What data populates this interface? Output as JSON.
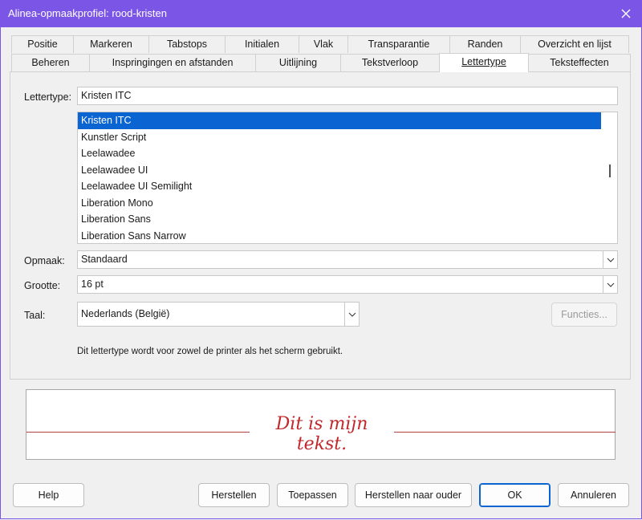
{
  "window": {
    "title": "Alinea-opmaakprofiel: rood-kristen"
  },
  "tabs_row1": [
    "Positie",
    "Markeren",
    "Tabstops",
    "Initialen",
    "Vlak",
    "Transparantie",
    "Randen",
    "Overzicht en lijst"
  ],
  "tabs_row2": [
    "Beheren",
    "Inspringingen en afstanden",
    "Uitlijning",
    "Tekstverloop",
    "Lettertype",
    "Teksteffecten"
  ],
  "active_tab": "Lettertype",
  "font": {
    "label": "Lettertype:",
    "value": "Kristen ITC",
    "list": [
      "Kristen ITC",
      "Kunstler Script",
      "Leelawadee",
      "Leelawadee UI",
      "Leelawadee UI Semilight",
      "Liberation Mono",
      "Liberation Sans",
      "Liberation Sans Narrow"
    ],
    "selected_index": 0
  },
  "style": {
    "label": "Opmaak:",
    "value": "Standaard"
  },
  "size": {
    "label": "Grootte:",
    "value": "16 pt"
  },
  "language": {
    "label": "Taal:",
    "value": "Nederlands (België)"
  },
  "features_button": "Functies...",
  "info_text": "Dit lettertype wordt voor zowel de printer als het scherm gebruikt.",
  "preview": {
    "text": "Dit is mijn tekst.",
    "color": "#c0282c"
  },
  "buttons": {
    "help": "Help",
    "reset": "Herstellen",
    "apply": "Toepassen",
    "reset_parent": "Herstellen naar ouder",
    "ok": "OK",
    "cancel": "Annuleren"
  },
  "colors": {
    "titlebar": "#7b55e6",
    "selection": "#0a64d2"
  }
}
